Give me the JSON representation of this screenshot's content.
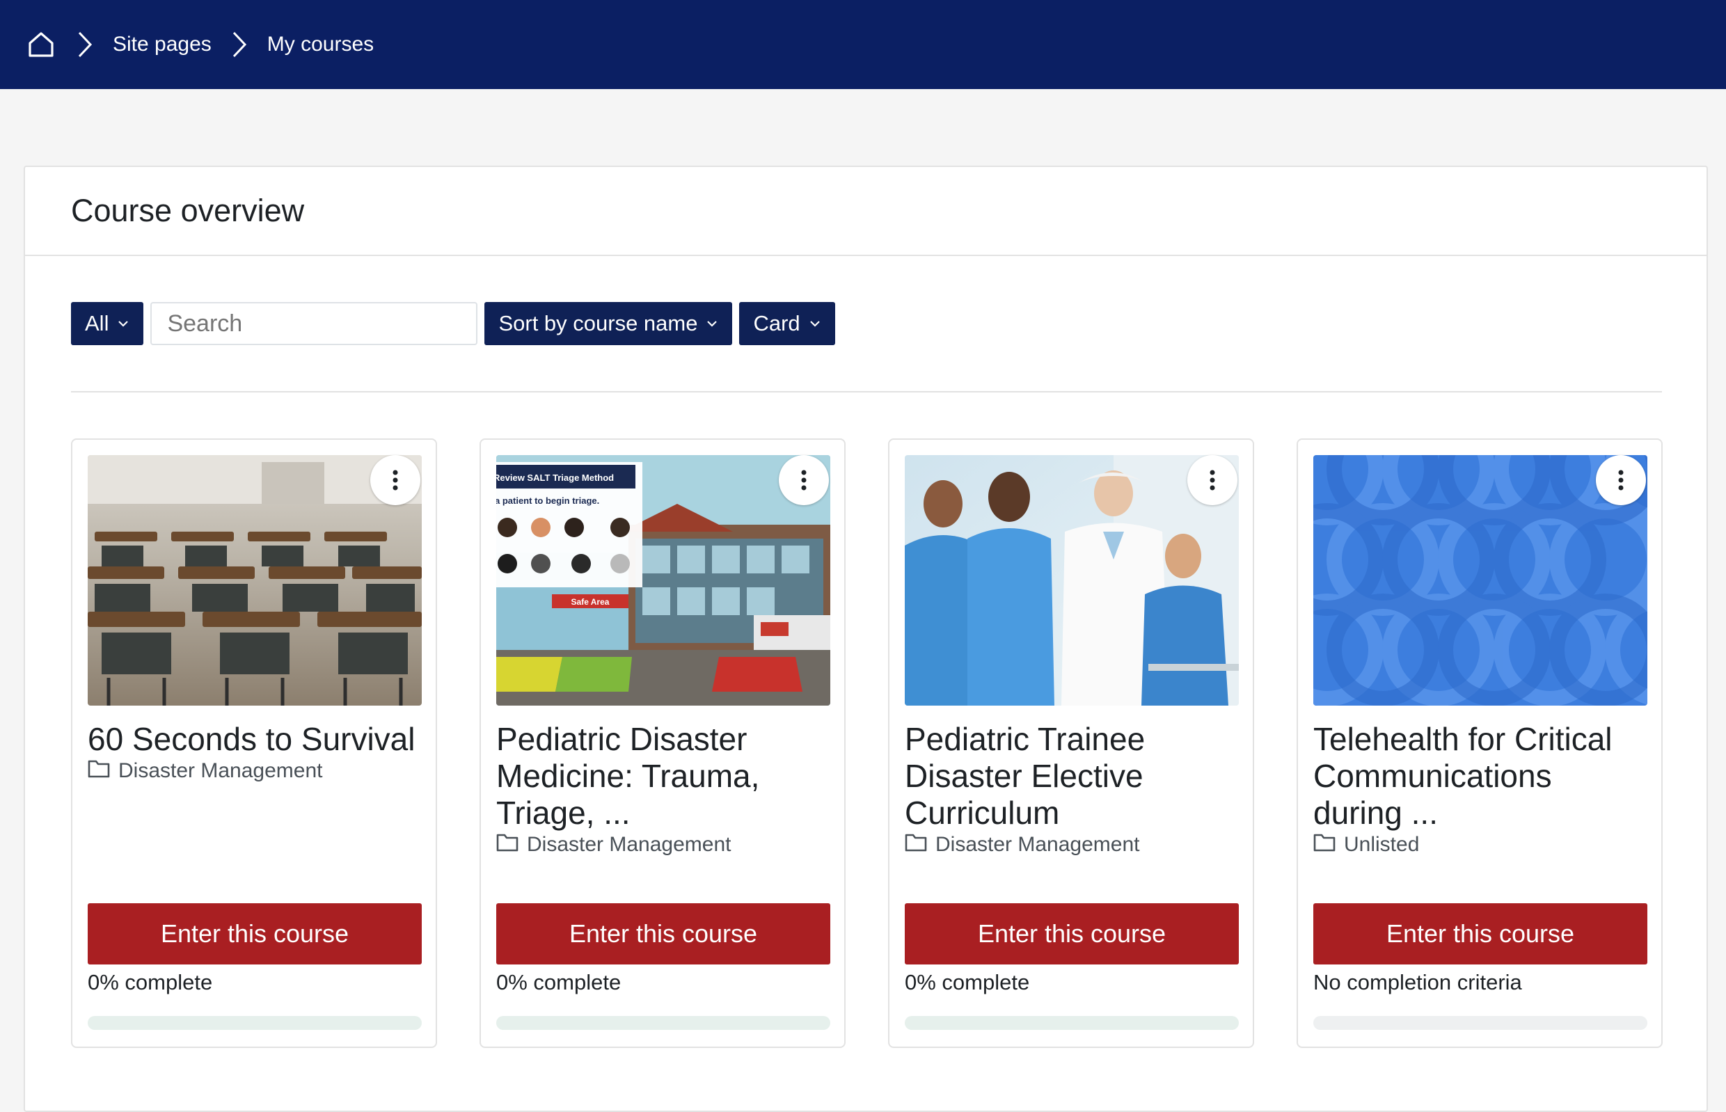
{
  "breadcrumb": {
    "home_icon": "home-icon",
    "items": [
      "Site pages",
      "My courses"
    ]
  },
  "overview": {
    "title": "Course overview",
    "filter_label": "All",
    "search_placeholder": "Search",
    "sort_label": "Sort by course name",
    "view_label": "Card"
  },
  "courses": [
    {
      "title": "60 Seconds to Survival",
      "category": "Disaster Management",
      "enter_label": "Enter this course",
      "progress_label": "0% complete",
      "progress": 0
    },
    {
      "title": "Pediatric Disaster Medicine: Trauma, Triage, ...",
      "category": "Disaster Management",
      "enter_label": "Enter this course",
      "progress_label": "0% complete",
      "progress": 0,
      "image_text": {
        "line1": "Review SALT Triage Method",
        "line2": "a patient to begin triage.",
        "sign": "Safe Area"
      }
    },
    {
      "title": "Pediatric Trainee Disaster Elective Curriculum",
      "category": "Disaster Management",
      "enter_label": "Enter this course",
      "progress_label": "0% complete",
      "progress": 0
    },
    {
      "title": "Telehealth for Critical Communications during ...",
      "category": "Unlisted",
      "enter_label": "Enter this course",
      "progress_label": "No completion criteria",
      "progress": 0
    }
  ],
  "colors": {
    "topbar": "#0b1f63",
    "primary_button": "#0f2156",
    "enter_button": "#a91f22",
    "progress_track": "#e6f0ec"
  }
}
